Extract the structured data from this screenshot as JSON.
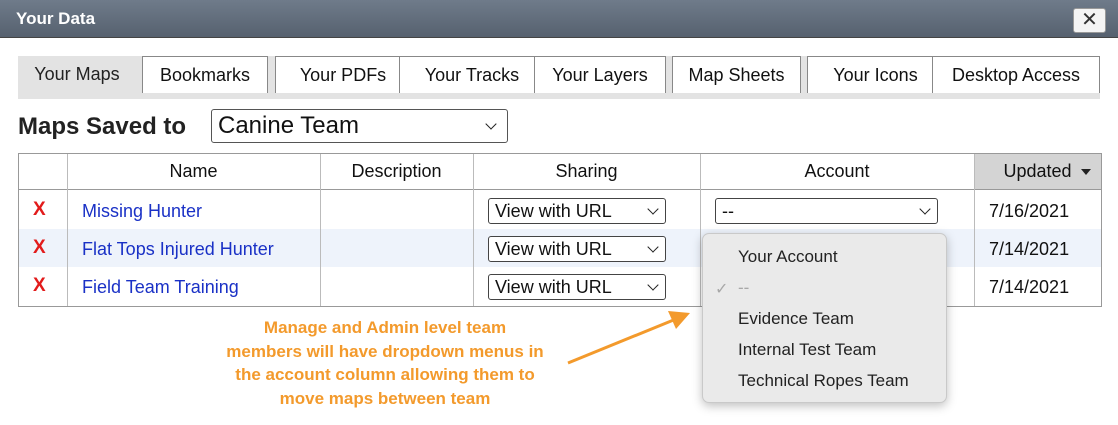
{
  "window": {
    "title": "Your Data",
    "close_label": "✕"
  },
  "tabs": [
    {
      "label": "Your Maps"
    },
    {
      "label": "Bookmarks"
    },
    {
      "label": "Your PDFs"
    },
    {
      "label": "Your Tracks"
    },
    {
      "label": "Your Layers"
    },
    {
      "label": "Map Sheets"
    },
    {
      "label": "Your Icons"
    },
    {
      "label": "Desktop Access"
    }
  ],
  "saved_to": {
    "label": "Maps Saved to",
    "value": "Canine Team"
  },
  "table": {
    "headers": {
      "name": "Name",
      "description": "Description",
      "sharing": "Sharing",
      "account": "Account",
      "updated": "Updated"
    },
    "rows": [
      {
        "delete": "X",
        "name": "Missing Hunter",
        "description": "",
        "sharing": "View with URL",
        "account": "--",
        "updated": "7/16/2021"
      },
      {
        "delete": "X",
        "name": "Flat Tops Injured Hunter",
        "description": "",
        "sharing": "View with URL",
        "account": "",
        "updated": "7/14/2021"
      },
      {
        "delete": "X",
        "name": "Field Team Training",
        "description": "",
        "sharing": "View with URL",
        "account": "",
        "updated": "7/14/2021"
      }
    ]
  },
  "account_dropdown": {
    "options": [
      {
        "label": "Your Account",
        "selected": false
      },
      {
        "label": "--",
        "selected": true
      },
      {
        "label": "Evidence Team",
        "selected": false
      },
      {
        "label": "Internal Test Team",
        "selected": false
      },
      {
        "label": "Technical Ropes Team",
        "selected": false
      }
    ],
    "check": "✓"
  },
  "annotation": {
    "lines": [
      "Manage and Admin level team",
      "members will have dropdown menus in",
      "the account column allowing them to",
      "move maps between team"
    ],
    "color": "#f39a2c"
  },
  "colors": {
    "link": "#1a31c6",
    "delete": "#e21b1b",
    "titlebar": "#5f6a78",
    "row_alt": "#eef3fb"
  }
}
